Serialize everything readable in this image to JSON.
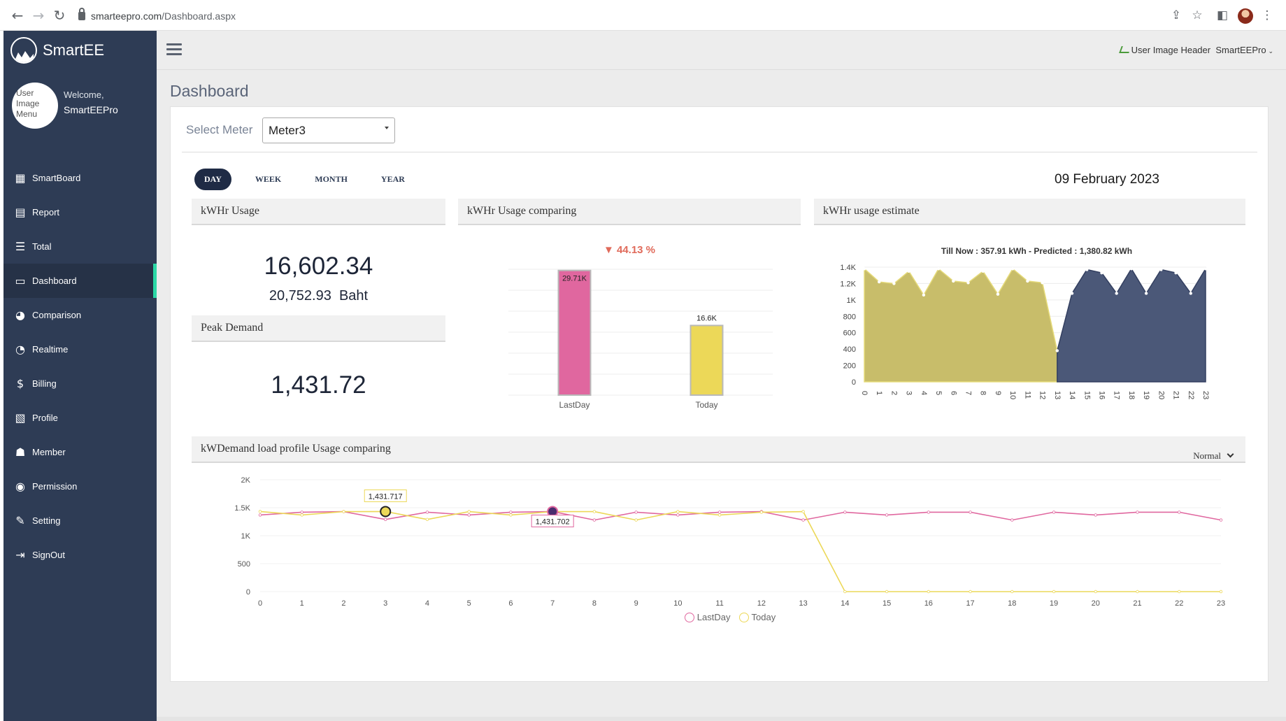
{
  "browser": {
    "url_host": "smarteepro.com",
    "url_path": "/Dashboard.aspx",
    "back_icon": "arrow-left",
    "forward_icon": "arrow-right",
    "reload_icon": "reload",
    "share_icon": "share",
    "star_icon": "star",
    "sidepanel_icon": "side-panel",
    "menu_icon": "more-vert"
  },
  "sidebar": {
    "brand": "SmartEE",
    "avatar_alt": "User Image Menu",
    "welcome": "Welcome,",
    "username": "SmartEEPro",
    "items": [
      {
        "label": "SmartBoard",
        "icon": "dashboard-grid"
      },
      {
        "label": "Report",
        "icon": "table"
      },
      {
        "label": "Total",
        "icon": "list"
      },
      {
        "label": "Dashboard",
        "icon": "monitor",
        "active": true
      },
      {
        "label": "Comparison",
        "icon": "pie"
      },
      {
        "label": "Realtime",
        "icon": "gauge"
      },
      {
        "label": "Billing",
        "icon": "dollar"
      },
      {
        "label": "Profile",
        "icon": "file-chart"
      },
      {
        "label": "Member",
        "icon": "user-plus"
      },
      {
        "label": "Permission",
        "icon": "eye-slash"
      },
      {
        "label": "Setting",
        "icon": "wrench"
      },
      {
        "label": "SignOut",
        "icon": "sign-out"
      }
    ]
  },
  "header": {
    "user_image_alt": "User Image Header",
    "user_name": "SmartEEPro"
  },
  "page": {
    "title": "Dashboard",
    "meter_label": "Select Meter",
    "meter_value": "Meter3",
    "tabs": [
      "DAY",
      "WEEK",
      "MONTH",
      "YEAR"
    ],
    "active_tab": "DAY",
    "date": "09 February 2023"
  },
  "usage": {
    "title": "kWHr Usage",
    "kwh": "16,602.34",
    "baht_value": "20,752.93",
    "baht_unit": "Baht"
  },
  "peak": {
    "title": "Peak Demand",
    "value": "1,431.72"
  },
  "comparing": {
    "title": "kWHr Usage comparing",
    "change": "▼ 44.13 %"
  },
  "estimate": {
    "title": "kWHr usage estimate",
    "subtitle": "Till Now : 357.91 kWh - Predicted : 1,380.82 kWh"
  },
  "loadprofile": {
    "title": "kWDemand load profile Usage comparing",
    "mode": "Normal",
    "tooltip_today": "1,431.717",
    "tooltip_lastday": "1,431.702"
  },
  "colors": {
    "sidebar": "#2e3c55",
    "lastday": "#e0679f",
    "today": "#ecd858",
    "estimate_actual": "#c8bd6a",
    "estimate_predicted": "#4b5878",
    "decrease": "#e06a5a"
  },
  "chart_data": [
    {
      "type": "bar",
      "title": "kWHr Usage comparing",
      "categories": [
        "LastDay",
        "Today"
      ],
      "values": [
        29710,
        16600
      ],
      "data_labels": [
        "29.71K",
        "16.6K"
      ],
      "ylim": [
        0,
        30000
      ]
    },
    {
      "type": "area",
      "title": "Till Now : 357.91 kWh - Predicted : 1,380.82 kWh",
      "x": [
        0,
        1,
        2,
        3,
        4,
        5,
        6,
        7,
        8,
        9,
        10,
        11,
        12,
        13,
        14,
        15,
        16,
        17,
        18,
        19,
        20,
        21,
        22,
        23
      ],
      "y_ticks": [
        "0",
        "200",
        "400",
        "600",
        "800",
        "1K",
        "1.2K",
        "1.4K"
      ],
      "ylim": [
        0,
        1400
      ],
      "series": [
        {
          "values": [
            1380,
            1220,
            1200,
            1350,
            1060,
            1380,
            1230,
            1210,
            1350,
            1070,
            1380,
            1230,
            1210,
            380,
            null,
            null,
            null,
            null,
            null,
            null,
            null,
            null,
            null,
            null
          ]
        },
        {
          "values": [
            null,
            null,
            null,
            null,
            null,
            null,
            null,
            null,
            null,
            null,
            null,
            null,
            null,
            380,
            1080,
            1370,
            1330,
            1080,
            1380,
            1080,
            1370,
            1330,
            1080,
            1380
          ]
        }
      ]
    },
    {
      "type": "line",
      "title": "kWDemand load profile Usage comparing",
      "x": [
        0,
        1,
        2,
        3,
        4,
        5,
        6,
        7,
        8,
        9,
        10,
        11,
        12,
        13,
        14,
        15,
        16,
        17,
        18,
        19,
        20,
        21,
        22,
        23
      ],
      "y_ticks": [
        "0",
        "500",
        "1K",
        "1.5K",
        "2K"
      ],
      "ylim": [
        0,
        2000
      ],
      "series": [
        {
          "name": "LastDay",
          "values": [
            1370,
            1420,
            1430,
            1290,
            1420,
            1370,
            1420,
            1431.702,
            1280,
            1420,
            1370,
            1420,
            1430,
            1280,
            1420,
            1370,
            1420,
            1420,
            1280,
            1420,
            1370,
            1420,
            1420,
            1280
          ]
        },
        {
          "name": "Today",
          "values": [
            1431.717,
            1370,
            1430,
            1431.717,
            1290,
            1430,
            1370,
            1430,
            1430,
            1280,
            1430,
            1370,
            1420,
            1430,
            0,
            0,
            0,
            0,
            0,
            0,
            0,
            0,
            0,
            0
          ]
        }
      ]
    }
  ]
}
